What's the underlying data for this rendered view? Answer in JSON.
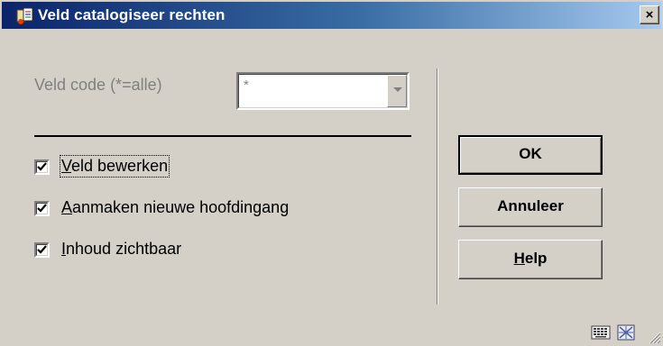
{
  "window": {
    "title": "Veld catalogiseer rechten",
    "close_label": "×",
    "app_icon": "catalog-app-icon"
  },
  "form": {
    "field_label": "Veld code (*=alle)",
    "field_value": "*",
    "field_enabled": false
  },
  "checkboxes": [
    {
      "label": "Veld bewerken",
      "mnemonic": "V",
      "checked": true
    },
    {
      "label": "Aanmaken nieuwe hoofdingang",
      "mnemonic": "A",
      "checked": true
    },
    {
      "label": "Inhoud zichtbaar",
      "mnemonic": "I",
      "checked": true
    }
  ],
  "buttons": {
    "ok": "OK",
    "cancel": "Annuleer",
    "help": "Help",
    "help_mnemonic": "H"
  },
  "status_icons": [
    "keyboard-icon",
    "grid-icon"
  ],
  "colors": {
    "title_gradient_start": "#0a246a",
    "title_gradient_end": "#a6caf0",
    "dialog_face": "#d4d0c8",
    "disabled_text": "#808080"
  }
}
